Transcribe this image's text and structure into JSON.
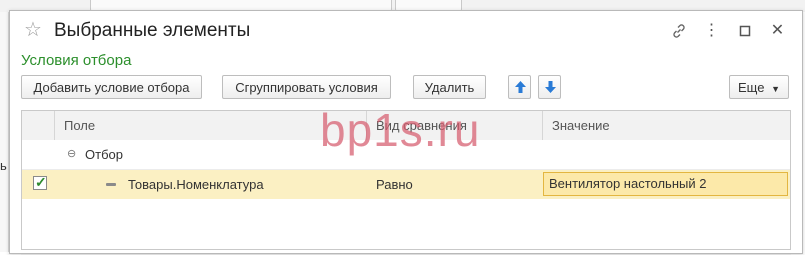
{
  "background": {
    "left_glyph": "ь"
  },
  "window": {
    "title": "Выбранные элементы",
    "star_icon": "star-icon",
    "controls": [
      "link-icon",
      "more-icon",
      "maximize-icon",
      "close-icon"
    ]
  },
  "section": {
    "title": "Условия отбора"
  },
  "toolbar": {
    "add_label": "Добавить условие отбора",
    "group_label": "Сгруппировать условия",
    "delete_label": "Удалить",
    "up_icon": "arrow-up-icon",
    "down_icon": "arrow-down-icon",
    "more_label": "Еще"
  },
  "table": {
    "headers": {
      "field": "Поле",
      "comparison": "Вид сравнения",
      "value": "Значение"
    },
    "group_row": {
      "label": "Отбор",
      "expanded": true
    },
    "rows": [
      {
        "checked": true,
        "field": "Товары.Номенклатура",
        "comparison": "Равно",
        "value": "Вентилятор настольный 2"
      }
    ]
  },
  "watermark": "bp1s.ru",
  "colors": {
    "section_title": "#2c8f2c",
    "row_highlight": "#fbf0c3",
    "value_field": "#fce9a9",
    "arrow_blue": "#2a7bd6",
    "watermark": "#d65c6e"
  }
}
